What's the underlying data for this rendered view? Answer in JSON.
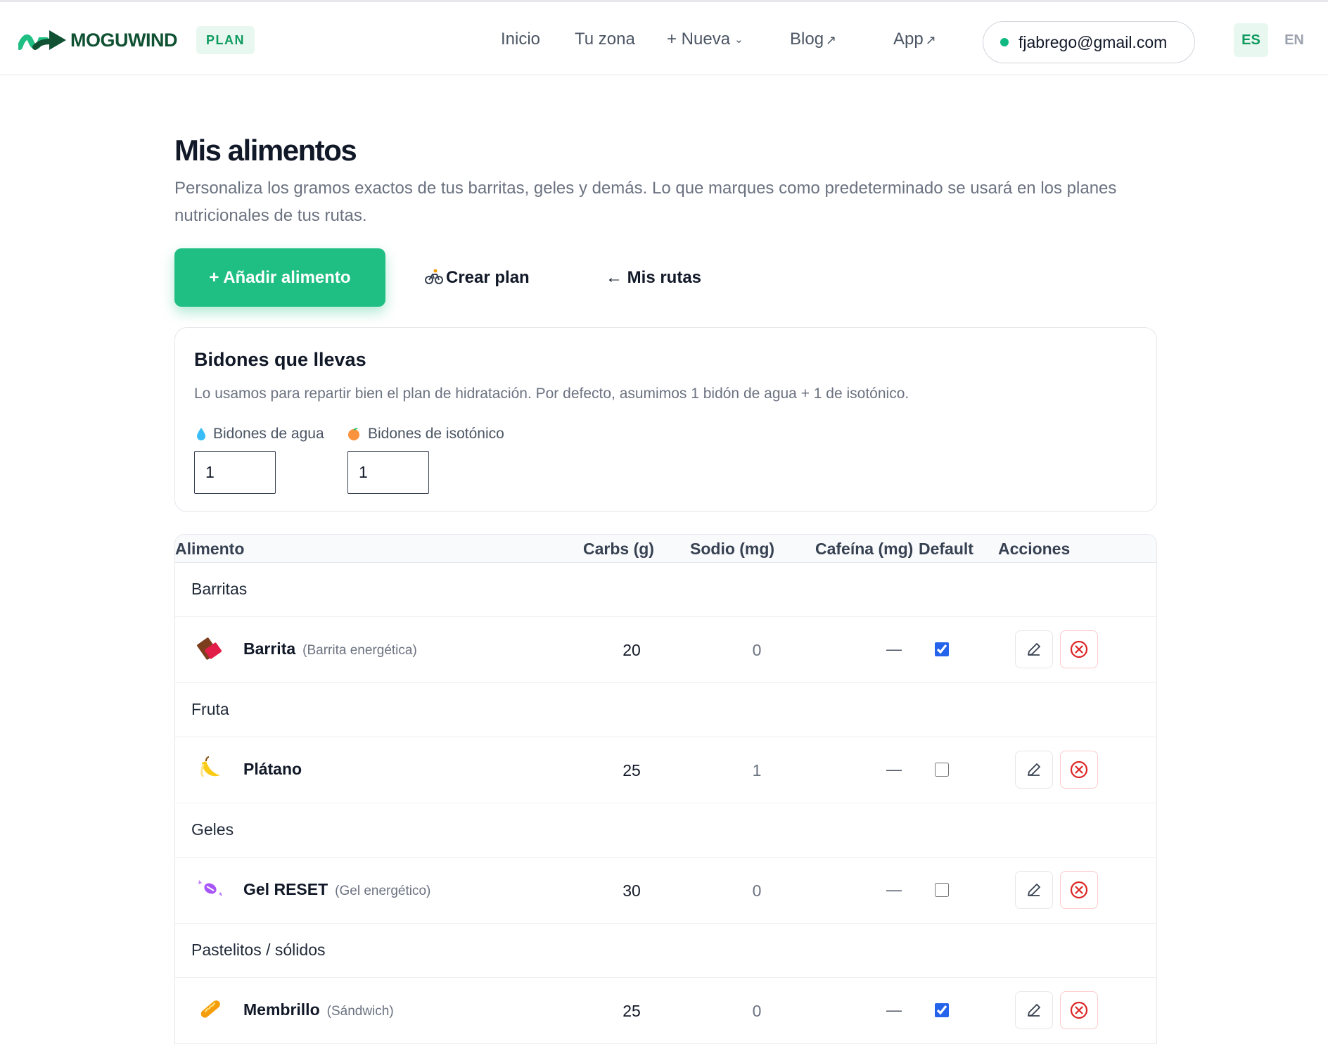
{
  "brand": {
    "name": "MOGUWIND",
    "badge": "PLAN",
    "accent": "#1fbf83",
    "dark": "#0f5132"
  },
  "nav": {
    "items": [
      {
        "label": "Inicio"
      },
      {
        "label": "Tu zona"
      },
      {
        "label": "+ Nueva",
        "icon": "chevron-down-icon"
      },
      {
        "label": "Blog",
        "icon": "external-link-icon"
      },
      {
        "label": "App",
        "icon": "external-link-icon"
      }
    ],
    "user_email": "fjabrego@gmail.com",
    "user_status_color": "#10b981",
    "lang_active": "ES",
    "lang_other": "EN"
  },
  "page": {
    "title": "Mis alimentos",
    "description": "Personaliza los gramos exactos de tus barritas, geles y demás. Lo que marques como predeterminado se usará en los planes nutricionales de tus rutas."
  },
  "actions": {
    "add_label": "+ Añadir alimento",
    "plan_label": "Crear plan",
    "plan_icon": "cyclist-icon",
    "routes_label": "← Mis rutas"
  },
  "bidones": {
    "title": "Bidones que llevas",
    "description": "Lo usamos para repartir bien el plan de hidratación. Por defecto, asumimos 1 bidón de agua + 1 de isotónico.",
    "water_label": "Bidones de agua",
    "water_icon": "droplet-icon",
    "water_value": "1",
    "iso_label": "Bidones de isotónico",
    "iso_icon": "peach-icon",
    "iso_value": "1"
  },
  "table": {
    "headers": {
      "food": "Alimento",
      "carbs": "Carbs (g)",
      "sodium": "Sodio (mg)",
      "caffeine": "Cafeína (mg)",
      "default": "Default",
      "actions": "Acciones"
    },
    "groups": [
      {
        "category": "Barritas",
        "item": {
          "icon": "chocolate-bar-icon",
          "name": "Barrita",
          "subtitle": "(Barrita energética)",
          "carbs": "20",
          "sodium": "0",
          "caffeine": "—",
          "default": true
        }
      },
      {
        "category": "Fruta",
        "item": {
          "icon": "banana-icon",
          "name": "Plátano",
          "subtitle": "",
          "carbs": "25",
          "sodium": "1",
          "caffeine": "—",
          "default": false
        }
      },
      {
        "category": "Geles",
        "item": {
          "icon": "candy-icon",
          "name": "Gel RESET",
          "subtitle": "(Gel energético)",
          "carbs": "30",
          "sodium": "0",
          "caffeine": "—",
          "default": false
        }
      },
      {
        "category": "Pastelitos / sólidos",
        "item": {
          "icon": "baguette-icon",
          "name": "Membrillo",
          "subtitle": "(Sándwich)",
          "carbs": "25",
          "sodium": "0",
          "caffeine": "—",
          "default": true
        }
      }
    ]
  }
}
